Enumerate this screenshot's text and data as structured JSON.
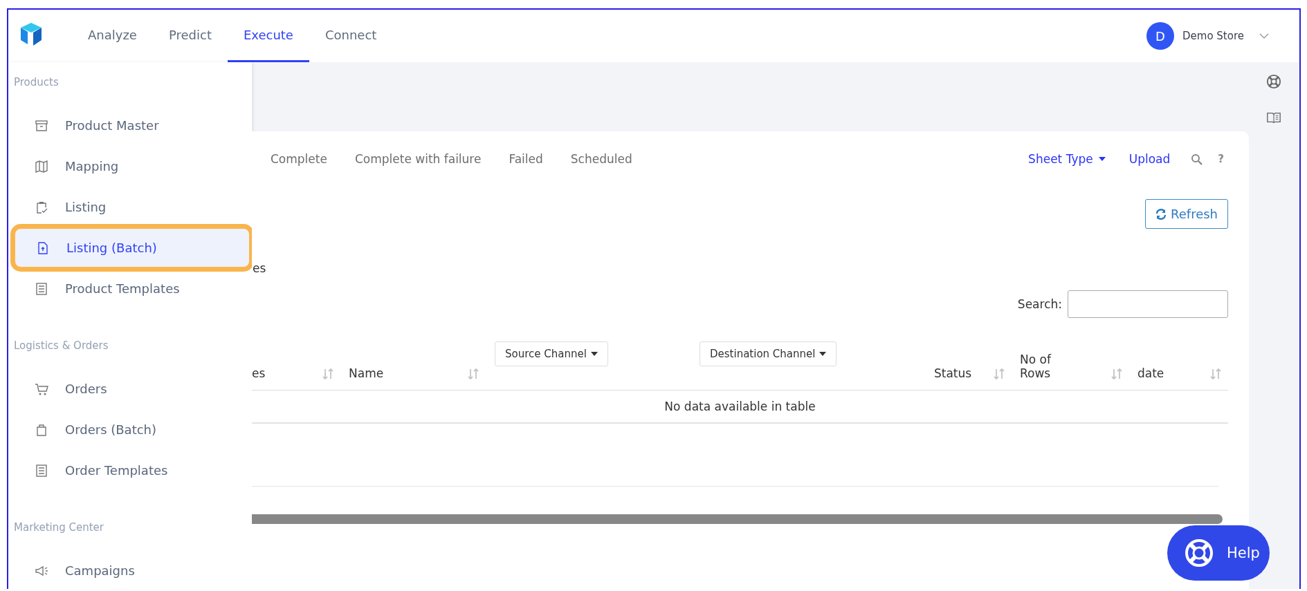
{
  "nav": {
    "tabs": [
      {
        "label": "Analyze",
        "selected": false
      },
      {
        "label": "Predict",
        "selected": false
      },
      {
        "label": "Execute",
        "selected": true
      },
      {
        "label": "Connect",
        "selected": false
      }
    ],
    "account": {
      "initial": "D",
      "name": "Demo Store"
    }
  },
  "sidebar": {
    "sections": [
      {
        "title": "Products",
        "items": [
          {
            "label": "Product Master",
            "selected": false,
            "outlined": false
          },
          {
            "label": "Mapping",
            "selected": false,
            "outlined": false
          },
          {
            "label": "Listing",
            "selected": false,
            "outlined": false
          },
          {
            "label": "Listing (Batch)",
            "selected": true,
            "outlined": true
          },
          {
            "label": "Product Templates",
            "selected": false,
            "outlined": false
          }
        ]
      },
      {
        "title": "Logistics & Orders",
        "items": [
          {
            "label": "Orders",
            "selected": false,
            "outlined": false
          },
          {
            "label": "Orders (Batch)",
            "selected": false,
            "outlined": false
          },
          {
            "label": "Order Templates",
            "selected": false,
            "outlined": false
          }
        ]
      },
      {
        "title": "Marketing Center",
        "items": [
          {
            "label": "Campaigns",
            "selected": false,
            "outlined": false
          }
        ]
      }
    ]
  },
  "card": {
    "tabs": [
      "Complete",
      "Complete with failure",
      "Failed",
      "Scheduled"
    ],
    "sheet_type": "Sheet Type",
    "upload": "Upload",
    "help_mark": "?",
    "refresh": "Refresh",
    "partial_text": "es",
    "search": {
      "label": "Search:"
    },
    "table": {
      "columns": [
        {
          "kind": "sort",
          "label": "es"
        },
        {
          "kind": "sort",
          "label": "Name"
        },
        {
          "kind": "dropdown",
          "label": "Source Channel"
        },
        {
          "kind": "dropdown",
          "label": "Destination Channel"
        },
        {
          "kind": "sort",
          "label": "Status"
        },
        {
          "kind": "sort",
          "label": "No of Rows"
        },
        {
          "kind": "sort",
          "label": "date"
        }
      ],
      "empty_message": "No data available in table"
    }
  },
  "help_button": "Help"
}
